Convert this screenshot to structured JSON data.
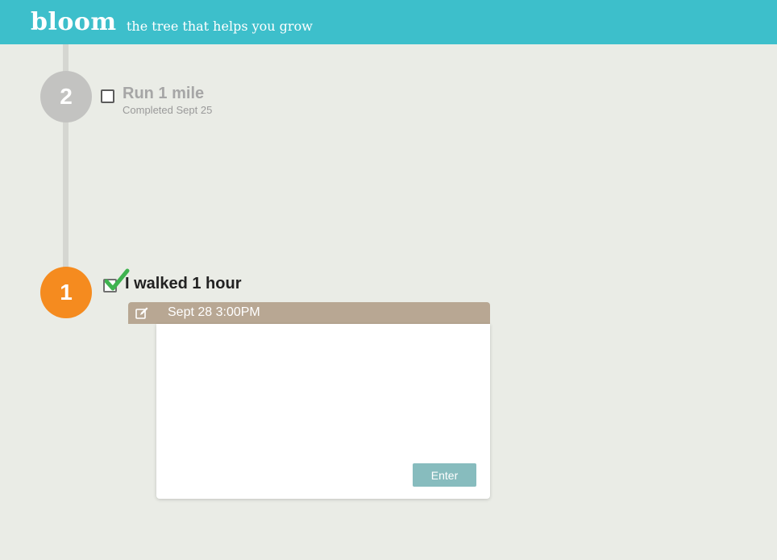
{
  "header": {
    "brand": "bloom",
    "tagline": "the tree that helps you grow",
    "background_color": "#3dbfcb"
  },
  "timeline": {
    "steps": [
      {
        "number": "2",
        "title": "Run 1 mile",
        "subtitle": "Completed Sept 25",
        "checked": false,
        "circle_color": "#c3c3c1"
      },
      {
        "number": "1",
        "title": "I walked 1 hour",
        "checked": true,
        "circle_color": "#f58b1f"
      }
    ]
  },
  "entry": {
    "edit_icon": "edit-icon",
    "date": "Sept 28 3:00PM",
    "text_value": "",
    "enter_label": "Enter",
    "header_color": "#b8a793",
    "button_color": "#87bcbe"
  },
  "icons": {
    "checkmark": "checkmark-icon"
  }
}
